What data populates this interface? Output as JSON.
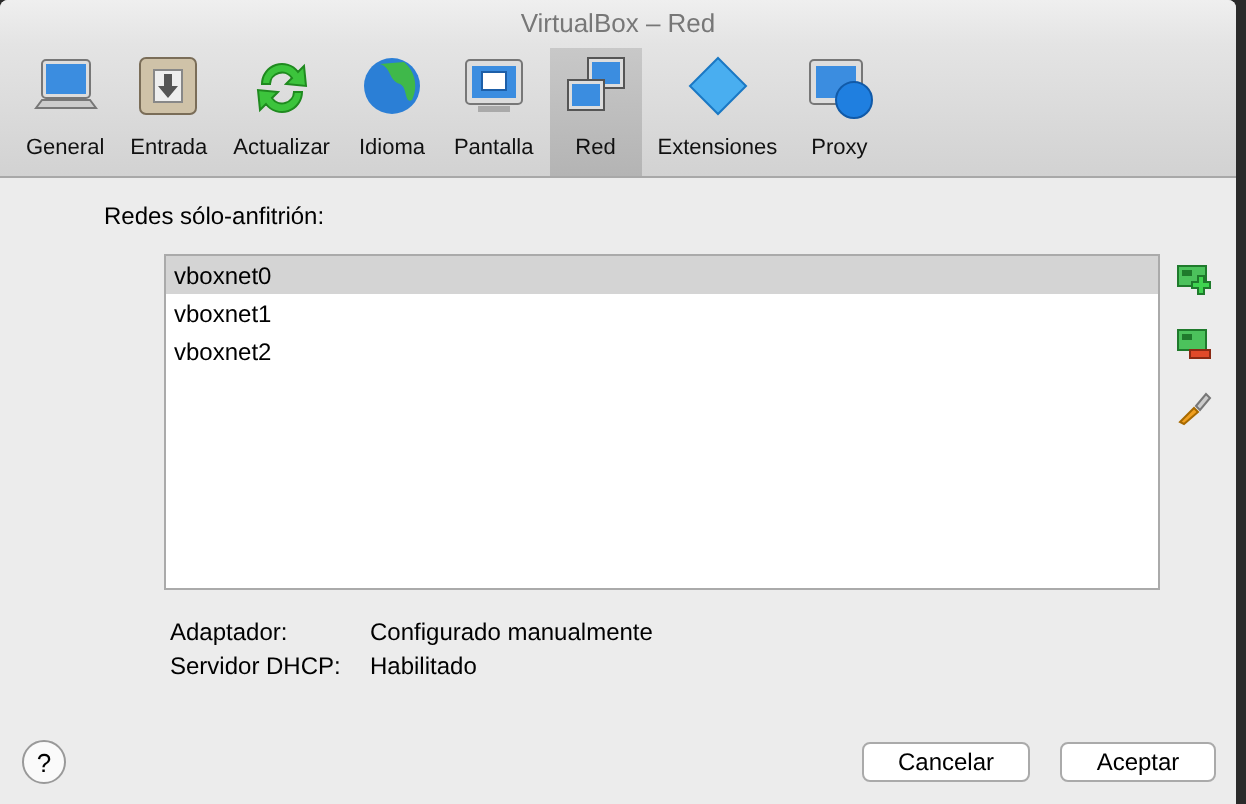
{
  "window": {
    "title": "VirtualBox – Red"
  },
  "tabs": [
    {
      "label": "General",
      "selected": false
    },
    {
      "label": "Entrada",
      "selected": false
    },
    {
      "label": "Actualizar",
      "selected": false
    },
    {
      "label": "Idioma",
      "selected": false
    },
    {
      "label": "Pantalla",
      "selected": false
    },
    {
      "label": "Red",
      "selected": true
    },
    {
      "label": "Extensiones",
      "selected": false
    },
    {
      "label": "Proxy",
      "selected": false
    }
  ],
  "networks": {
    "label": "Redes sólo-anfitrión:",
    "items": [
      {
        "name": "vboxnet0",
        "selected": true
      },
      {
        "name": "vboxnet1",
        "selected": false
      },
      {
        "name": "vboxnet2",
        "selected": false
      }
    ]
  },
  "details": [
    {
      "label": "Adaptador:",
      "value": "Configurado manualmente"
    },
    {
      "label": "Servidor DHCP:",
      "value": "Habilitado"
    }
  ],
  "buttons": [
    {
      "label": "Cancelar"
    },
    {
      "label": "Aceptar"
    }
  ],
  "help": {
    "label": "?"
  }
}
